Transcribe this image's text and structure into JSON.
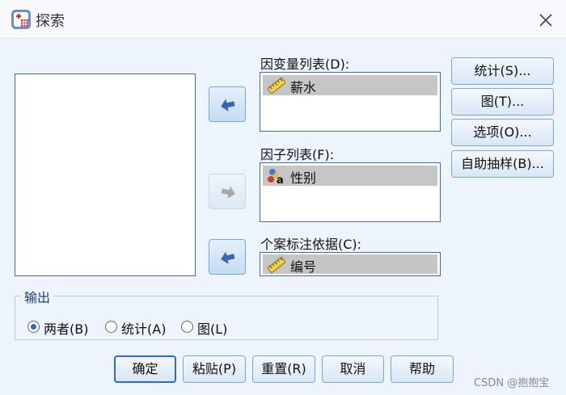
{
  "window": {
    "title": "探索"
  },
  "source_list": {
    "items": []
  },
  "dependent": {
    "label": "因变量列表(D):",
    "items": [
      {
        "label": "薪水",
        "icon": "scale-ruler-icon"
      }
    ]
  },
  "factor": {
    "label": "因子列表(F):",
    "items": [
      {
        "label": "性别",
        "icon": "nominal-variable-icon"
      }
    ]
  },
  "case_label": {
    "label": "个案标注依据(C):",
    "value": "编号",
    "icon": "scale-ruler-icon"
  },
  "side_buttons": {
    "statistics": "统计(S)...",
    "plots": "图(T)...",
    "options": "选项(O)...",
    "bootstrap": "自助抽样(B)..."
  },
  "output": {
    "title": "输出",
    "options": [
      {
        "label": "两者(B)",
        "selected": true
      },
      {
        "label": "统计(A)",
        "selected": false
      },
      {
        "label": "图(L)",
        "selected": false
      }
    ]
  },
  "bottom_buttons": {
    "ok": "确定",
    "paste": "粘贴(P)",
    "reset": "重置(R)",
    "cancel": "取消",
    "help": "帮助"
  },
  "watermark": "CSDN @抱抱宝",
  "colors": {
    "accent": "#2f6bc0",
    "background": "#eef4fb",
    "selection": "#c6c6c6"
  }
}
